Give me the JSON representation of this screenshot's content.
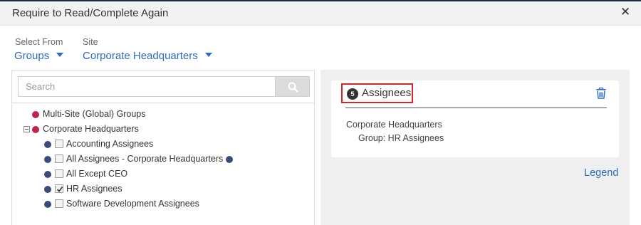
{
  "dialog": {
    "title": "Require to Read/Complete Again"
  },
  "selectors": {
    "select_from": {
      "label": "Select From",
      "value": "Groups"
    },
    "site": {
      "label": "Site",
      "value": "Corporate Headquarters"
    }
  },
  "search": {
    "placeholder": "Search",
    "value": ""
  },
  "tree": {
    "items": [
      {
        "label": "Multi-Site (Global) Groups",
        "dot_color": "#c0234a",
        "has_checkbox": false,
        "checked": false
      },
      {
        "label": "Corporate Headquarters",
        "dot_color": "#c0234a",
        "has_checkbox": false,
        "checked": false,
        "expanded": true
      },
      {
        "label": "Accounting Assignees",
        "dot_color": "#3b4b7a",
        "has_checkbox": true,
        "checked": false
      },
      {
        "label": "All Assignees - Corporate Headquarters",
        "dot_color": "#3b4b7a",
        "has_checkbox": true,
        "checked": false
      },
      {
        "label": "All Except CEO",
        "dot_color": "#3b4b7a",
        "has_checkbox": true,
        "checked": false
      },
      {
        "label": "HR Assignees",
        "dot_color": "#3b4b7a",
        "has_checkbox": true,
        "checked": true
      },
      {
        "label": "Software Development Assignees",
        "dot_color": "#3b4b7a",
        "has_checkbox": true,
        "checked": false
      }
    ]
  },
  "assignees": {
    "count": "5",
    "title": "Assignees",
    "site": "Corporate Headquarters",
    "group": "Group: HR Assignees"
  },
  "legend_label": "Legend",
  "colors": {
    "link_blue": "#2f6bbf",
    "highlight_red": "#d8232a"
  }
}
